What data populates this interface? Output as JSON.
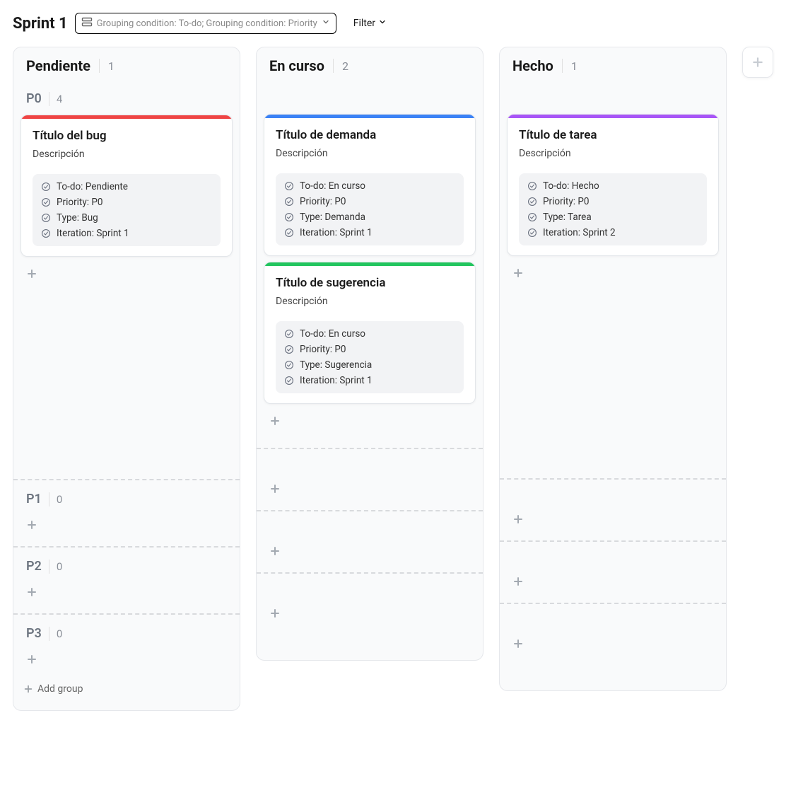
{
  "header": {
    "sprint_title": "Sprint 1",
    "grouping_text": "Grouping condition: To-do; Grouping condition: Priority",
    "filter_label": "Filter"
  },
  "columns": [
    {
      "title": "Pendiente",
      "count": 1
    },
    {
      "title": "En curso",
      "count": 2
    },
    {
      "title": "Hecho",
      "count": 1
    }
  ],
  "groups": [
    {
      "label": "P0",
      "count": 4
    },
    {
      "label": "P1",
      "count": 0
    },
    {
      "label": "P2",
      "count": 0
    },
    {
      "label": "P3",
      "count": 0
    }
  ],
  "cards": {
    "pendiente_p0": {
      "accent": "#ef4444",
      "title": "Título del bug",
      "desc": "Descripción",
      "props": [
        "To-do: Pendiente",
        "Priority: P0",
        "Type: Bug",
        "Iteration: Sprint 1"
      ]
    },
    "encurso_p0_a": {
      "accent": "#3b82f6",
      "title": "Título de demanda",
      "desc": "Descripción",
      "props": [
        "To-do: En curso",
        "Priority: P0",
        "Type: Demanda",
        "Iteration: Sprint 1"
      ]
    },
    "encurso_p0_b": {
      "accent": "#22c55e",
      "title": "Título de sugerencia",
      "desc": "Descripción",
      "props": [
        "To-do: En curso",
        "Priority: P0",
        "Type: Sugerencia",
        "Iteration: Sprint 1"
      ]
    },
    "hecho_p0": {
      "accent": "#a855f7",
      "title": "Título de tarea",
      "desc": "Descripción",
      "props": [
        "To-do: Hecho",
        "Priority: P0",
        "Type: Tarea",
        "Iteration: Sprint 2"
      ]
    }
  },
  "add_group_label": "Add group"
}
